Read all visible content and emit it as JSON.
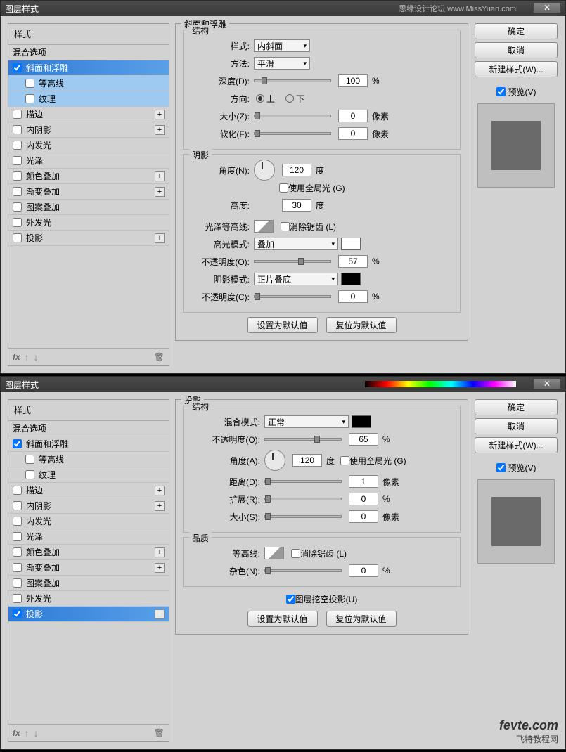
{
  "dialog1": {
    "title": "图层样式",
    "forum": "思缘设计论坛 www.MissYuan.com",
    "sidebar": {
      "head": "样式",
      "blend": "混合选项",
      "items": [
        {
          "label": "斜面和浮雕",
          "checked": true,
          "sel": true
        },
        {
          "label": "等高线",
          "checked": false,
          "sub": true
        },
        {
          "label": "纹理",
          "checked": false,
          "sub": true
        },
        {
          "label": "描边",
          "checked": false,
          "plus": true
        },
        {
          "label": "内阴影",
          "checked": false,
          "plus": true
        },
        {
          "label": "内发光",
          "checked": false
        },
        {
          "label": "光泽",
          "checked": false
        },
        {
          "label": "颜色叠加",
          "checked": false,
          "plus": true
        },
        {
          "label": "渐变叠加",
          "checked": false,
          "plus": true
        },
        {
          "label": "图案叠加",
          "checked": false
        },
        {
          "label": "外发光",
          "checked": false
        },
        {
          "label": "投影",
          "checked": false,
          "plus": true
        }
      ]
    },
    "panel_title": "斜面和浮雕",
    "struct": {
      "legend": "结构",
      "style_l": "样式:",
      "style_v": "内斜面",
      "tech_l": "方法:",
      "tech_v": "平滑",
      "depth_l": "深度(D):",
      "depth_v": "100",
      "depth_u": "%",
      "dir_l": "方向:",
      "up": "上",
      "down": "下",
      "size_l": "大小(Z):",
      "size_v": "0",
      "size_u": "像素",
      "soft_l": "软化(F):",
      "soft_v": "0",
      "soft_u": "像素"
    },
    "shade": {
      "legend": "阴影",
      "angle_l": "角度(N):",
      "angle_v": "120",
      "angle_u": "度",
      "global": "使用全局光 (G)",
      "alt_l": "高度:",
      "alt_v": "30",
      "alt_u": "度",
      "gloss_l": "光泽等高线:",
      "aa": "消除锯齿 (L)",
      "hmode_l": "高光模式:",
      "hmode_v": "叠加",
      "hop_l": "不透明度(O):",
      "hop_v": "57",
      "hop_u": "%",
      "smode_l": "阴影模式:",
      "smode_v": "正片叠底",
      "sop_l": "不透明度(C):",
      "sop_v": "0",
      "sop_u": "%"
    },
    "btnDefault": "设置为默认值",
    "btnReset": "复位为默认值",
    "right": {
      "ok": "确定",
      "cancel": "取消",
      "newstyle": "新建样式(W)...",
      "preview": "预览(V)"
    }
  },
  "dialog2": {
    "title": "图层样式",
    "sidebar": {
      "head": "样式",
      "blend": "混合选项",
      "items": [
        {
          "label": "斜面和浮雕",
          "checked": true
        },
        {
          "label": "等高线",
          "checked": false,
          "sub": true,
          "nosel": true
        },
        {
          "label": "纹理",
          "checked": false,
          "sub": true,
          "nosel": true
        },
        {
          "label": "描边",
          "checked": false,
          "plus": true
        },
        {
          "label": "内阴影",
          "checked": false,
          "plus": true
        },
        {
          "label": "内发光",
          "checked": false
        },
        {
          "label": "光泽",
          "checked": false
        },
        {
          "label": "颜色叠加",
          "checked": false,
          "plus": true
        },
        {
          "label": "渐变叠加",
          "checked": false,
          "plus": true
        },
        {
          "label": "图案叠加",
          "checked": false
        },
        {
          "label": "外发光",
          "checked": false
        },
        {
          "label": "投影",
          "checked": true,
          "sel": true,
          "plus": true
        }
      ]
    },
    "panel_title": "投影",
    "struct": {
      "legend": "结构",
      "bmode_l": "混合模式:",
      "bmode_v": "正常",
      "op_l": "不透明度(O):",
      "op_v": "65",
      "op_u": "%",
      "angle_l": "角度(A):",
      "angle_v": "120",
      "angle_u": "度",
      "global": "使用全局光 (G)",
      "dist_l": "距离(D):",
      "dist_v": "1",
      "dist_u": "像素",
      "spread_l": "扩展(R):",
      "spread_v": "0",
      "spread_u": "%",
      "size_l": "大小(S):",
      "size_v": "0",
      "size_u": "像素"
    },
    "qual": {
      "legend": "品质",
      "contour_l": "等高线:",
      "aa": "消除锯齿 (L)",
      "noise_l": "杂色(N):",
      "noise_v": "0",
      "noise_u": "%"
    },
    "knock": "图层挖空投影(U)",
    "btnDefault": "设置为默认值",
    "btnReset": "复位为默认值",
    "right": {
      "ok": "确定",
      "cancel": "取消",
      "newstyle": "新建样式(W)...",
      "preview": "预览(V)"
    }
  },
  "watermark": {
    "big": "fevte.com",
    "sm": "飞特教程网"
  }
}
